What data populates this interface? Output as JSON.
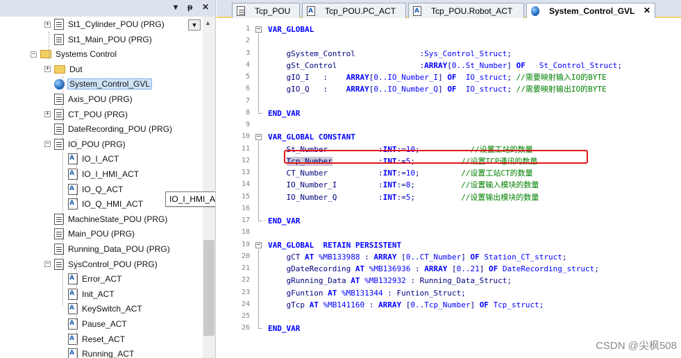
{
  "tree": {
    "header_buttons": [
      "▾",
      "ᵽ",
      "✕"
    ],
    "items": [
      {
        "label": "St1_Cylinder_POU (PRG)",
        "icon": "pou-icon",
        "expander": "+"
      },
      {
        "label": "St1_Main_POU (PRG)",
        "icon": "pou-icon",
        "expander": ""
      },
      {
        "label": "Systems Control",
        "icon": "folder-icon",
        "expander": "−"
      },
      {
        "label": "Dut",
        "icon": "folder-icon",
        "expander": "+"
      },
      {
        "label": "System_Control_GVL",
        "icon": "gvl-globe-icon",
        "expander": "",
        "selected": true
      },
      {
        "label": "Axis_POU (PRG)",
        "icon": "pou-icon",
        "expander": ""
      },
      {
        "label": "CT_POU (PRG)",
        "icon": "pou-icon",
        "expander": "+"
      },
      {
        "label": "DateRecording_POU (PRG)",
        "icon": "pou-icon",
        "expander": ""
      },
      {
        "label": "IO_POU (PRG)",
        "icon": "pou-icon",
        "expander": "−"
      },
      {
        "label": "IO_I_ACT",
        "icon": "action-icon",
        "expander": ""
      },
      {
        "label": "IO_I_HMI_ACT",
        "icon": "action-icon",
        "expander": ""
      },
      {
        "label": "IO_Q_ACT",
        "icon": "action-icon",
        "expander": ""
      },
      {
        "label": "IO_Q_HMI_ACT",
        "icon": "action-icon",
        "expander": ""
      },
      {
        "label": "MachineState_POU (PRG)",
        "icon": "pou-icon",
        "expander": ""
      },
      {
        "label": "Main_POU (PRG)",
        "icon": "pou-icon",
        "expander": ""
      },
      {
        "label": "Running_Data_POU (PRG)",
        "icon": "pou-icon",
        "expander": ""
      },
      {
        "label": "SysControl_POU (PRG)",
        "icon": "pou-icon",
        "expander": "−"
      },
      {
        "label": "Error_ACT",
        "icon": "action-icon",
        "expander": ""
      },
      {
        "label": "Init_ACT",
        "icon": "action-icon",
        "expander": ""
      },
      {
        "label": "KeySwitch_ACT",
        "icon": "action-icon",
        "expander": ""
      },
      {
        "label": "Pause_ACT",
        "icon": "action-icon",
        "expander": ""
      },
      {
        "label": "Reset_ACT",
        "icon": "action-icon",
        "expander": ""
      },
      {
        "label": "Running_ACT",
        "icon": "action-icon",
        "expander": ""
      }
    ],
    "tooltip": "IO_I_HMI_ACT",
    "dropdown_glyph": "▼",
    "scroll_up_glyph": "▲"
  },
  "tabs": [
    {
      "label": "Tcp_POU",
      "icon": "pou-icon",
      "active": false
    },
    {
      "label": "Tcp_POU.PC_ACT",
      "icon": "action-icon",
      "active": false
    },
    {
      "label": "Tcp_POU.Robot_ACT",
      "icon": "action-icon",
      "active": false
    },
    {
      "label": "System_Control_GVL",
      "icon": "gvl-globe-icon",
      "active": true,
      "close": "✕"
    }
  ],
  "code": {
    "line_numbers": [
      "1",
      "2",
      "3",
      "4",
      "5",
      "6",
      "7",
      "8",
      "9",
      "10",
      "11",
      "12",
      "13",
      "14",
      "15",
      "16",
      "17",
      "18",
      "19",
      "20",
      "21",
      "22",
      "23",
      "24",
      "25",
      "26"
    ],
    "lines": [
      "VAR_GLOBAL",
      "",
      "    gSystem_Control              :Sys_Control_Struct;",
      "    gSt_Control                  :ARRAY[0..St_Number] OF   St_Control_Struct;",
      "    gIO_I   :    ARRAY[0..IO_Number_I] OF  IO_struct; //需要映射输入IO的BYTE",
      "    gIO_Q   :    ARRAY[0..IO_Number_Q] OF  IO_struct; //需要映射输出IO的BYTE",
      "",
      "END_VAR",
      "",
      "VAR_GLOBAL CONSTANT",
      "    St_Number           :INT:=10;           //设置工站的数量",
      "    Tcp_Number          :INT:=5;          //设置TCP通讯的数量",
      "    CT_Number           :INT:=10;         //设置工站CT的数量",
      "    IO_Number_I         :INT:=8;          //设置输入模块的数量",
      "    IO_Number_Q         :INT:=5;          //设置输出模块的数量",
      "",
      "END_VAR",
      "",
      "VAR_GLOBAL  RETAIN PERSISTENT",
      "    gCT AT %MB133988 : ARRAY [0..CT_Number] OF Station_CT_struct;",
      "    gDateRecording AT %MB136936 : ARRAY [0..21] OF DateRecording_struct;",
      "    gRunning_Data AT %MB132932 : Running_Data_Struct;",
      "    gFuntion AT %MB131344 : Funtion_Struct;",
      "    gTcp AT %MB141160 : ARRAY [0..Tcp_Number] OF Tcp_struct;",
      "",
      "END_VAR"
    ],
    "highlighted_line": "12"
  },
  "watermark": "CSDN @尖枫508",
  "colors": {
    "keyword": "#0000ff",
    "comment": "#008000",
    "highlight_box": "#e5151a",
    "tab_accent": "#f6cf68",
    "selection": "#cde3f7"
  }
}
